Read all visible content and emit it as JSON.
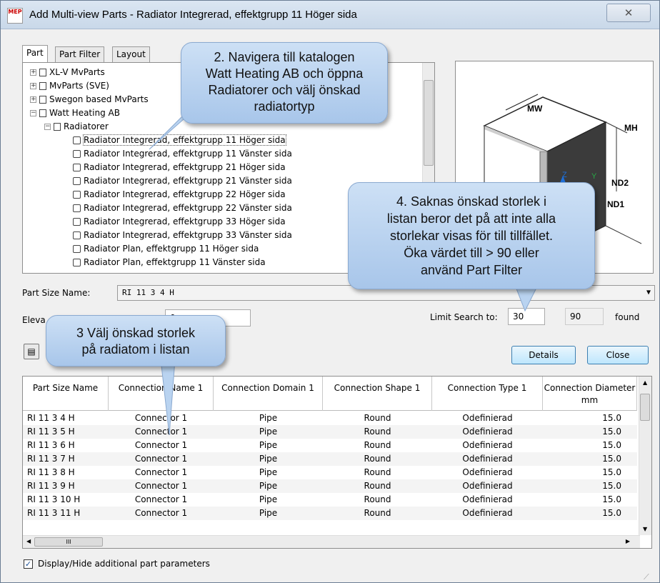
{
  "window": {
    "title": "Add Multi-view Parts - Radiator Integrerad, effektgrupp 11 Höger sida",
    "app_icon_text": "MEP",
    "close_symbol": "✕"
  },
  "tabs": [
    {
      "label": "Part"
    },
    {
      "label": "Part Filter"
    },
    {
      "label": "Layout"
    }
  ],
  "tree": {
    "items": [
      {
        "label": "XL-V MvParts",
        "toggle": "+"
      },
      {
        "label": "MvParts (SVE)",
        "toggle": "+"
      },
      {
        "label": "Swegon based MvParts",
        "toggle": "+"
      },
      {
        "label": "Watt Heating AB",
        "toggle": "−"
      },
      {
        "label": "Radiatorer",
        "toggle": "−"
      },
      {
        "label": "Radiator Integrerad, effektgrupp 11 Höger sida"
      },
      {
        "label": "Radiator Integrerad, effektgrupp 11 Vänster sida"
      },
      {
        "label": "Radiator Integrerad, effektgrupp 21 Höger sida"
      },
      {
        "label": "Radiator Integrerad, effektgrupp 21 Vänster sida"
      },
      {
        "label": "Radiator Integrerad, effektgrupp 22 Höger sida"
      },
      {
        "label": "Radiator Integrerad, effektgrupp 22 Vänster sida"
      },
      {
        "label": "Radiator Integrerad, effektgrupp 33 Höger sida"
      },
      {
        "label": "Radiator Integrerad, effektgrupp 33 Vänster sida"
      },
      {
        "label": "Radiator Plan, effektgrupp 11 Höger sida"
      },
      {
        "label": "Radiator Plan, effektgrupp 11 Vänster sida"
      }
    ]
  },
  "preview": {
    "labels": {
      "mw": "MW",
      "mh": "MH",
      "nd2": "ND2",
      "nd1": "ND1",
      "z": "Z",
      "y": "Y"
    }
  },
  "form": {
    "part_size_name_label": "Part Size Name:",
    "part_size_name_value": "RI 11 3  4 H",
    "elevation_label": "Eleva",
    "elevation_value": "0",
    "limit_search_label": "Limit Search to:",
    "limit_search_value": "30",
    "found_count": "90",
    "found_label": "found"
  },
  "buttons": {
    "details": "Details",
    "close": "Close"
  },
  "grid": {
    "columns": [
      "Part Size Name",
      "Connection Name 1",
      "Connection Domain 1",
      "Connection Shape 1",
      "Connection Type 1",
      "Connection Diameter mm"
    ],
    "rows": [
      [
        "RI 11 3  4 H",
        "Connector 1",
        "Pipe",
        "Round",
        "Odefinierad",
        "15.0"
      ],
      [
        "RI 11 3  5 H",
        "Connector 1",
        "Pipe",
        "Round",
        "Odefinierad",
        "15.0"
      ],
      [
        "RI 11 3  6 H",
        "Connector 1",
        "Pipe",
        "Round",
        "Odefinierad",
        "15.0"
      ],
      [
        "RI 11 3  7 H",
        "Connector 1",
        "Pipe",
        "Round",
        "Odefinierad",
        "15.0"
      ],
      [
        "RI 11 3  8 H",
        "Connector 1",
        "Pipe",
        "Round",
        "Odefinierad",
        "15.0"
      ],
      [
        "RI 11 3  9 H",
        "Connector 1",
        "Pipe",
        "Round",
        "Odefinierad",
        "15.0"
      ],
      [
        "RI 11 3  10 H",
        "Connector 1",
        "Pipe",
        "Round",
        "Odefinierad",
        "15.0"
      ],
      [
        "RI 11 3  11 H",
        "Connector 1",
        "Pipe",
        "Round",
        "Odefinierad",
        "15.0"
      ]
    ],
    "hscroll_thumb": "III"
  },
  "checkbox": {
    "label": "Display/Hide additional part parameters",
    "checked": true,
    "mark": "✓"
  },
  "callouts": {
    "c2": "2. Navigera till katalogen\nWatt Heating AB och öppna\nRadiatorer och välj önskad\nradiatortyp",
    "c3": "3 Välj önskad storlek\npå radiatom i listan",
    "c4": "4. Saknas önskad storlek i\nlistan beror det på att  inte alla\nstorlekar visas för till tillfället.\nÖka värdet till > 90 eller\nanvänd Part Filter"
  },
  "colors": {
    "callout_fill": "#b9d3f0",
    "button_border": "#3c7fb1"
  }
}
